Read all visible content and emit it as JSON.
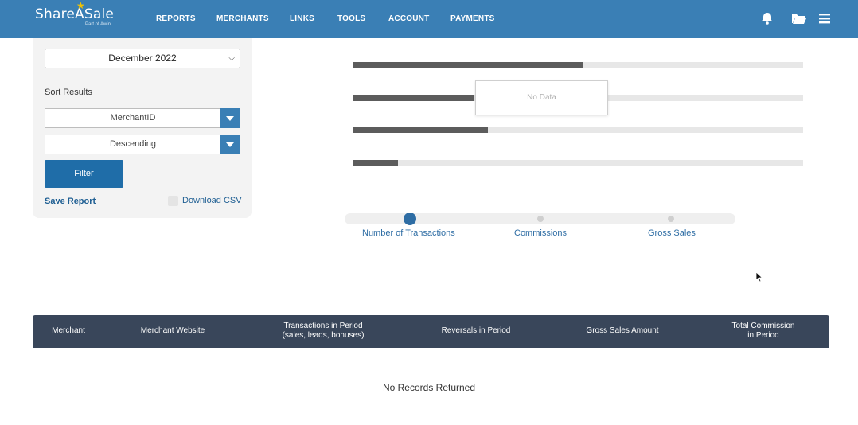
{
  "brand": {
    "name": "ShareASale",
    "tagline": "Part of Awin",
    "primary_color": "#3a7fb5",
    "star_color": "#f2c200"
  },
  "nav": {
    "items": [
      {
        "label": "REPORTS"
      },
      {
        "label": "MERCHANTS"
      },
      {
        "label": "LINKS"
      },
      {
        "label": "TOOLS"
      },
      {
        "label": "ACCOUNT"
      },
      {
        "label": "PAYMENTS"
      }
    ],
    "icons": [
      "bell-icon",
      "folder-icon",
      "menu-icon"
    ]
  },
  "filters": {
    "period": "December 2022",
    "sort_label": "Sort Results",
    "sort_field": "MerchantID",
    "sort_order": "Descending",
    "filter_button": "Filter",
    "save_report": "Save Report",
    "download_csv": "Download CSV",
    "download_csv_checked": false
  },
  "chart_data": {
    "type": "bar",
    "orientation": "horizontal",
    "series": [
      {
        "values": [
          0.51,
          0.27,
          0.3,
          0.1
        ]
      }
    ],
    "overlay_message": "No Data",
    "colors": {
      "fill": "#5c5c5c",
      "track": "#e7e7e7"
    }
  },
  "metric_selector": {
    "options": [
      "Number of Transactions",
      "Commissions",
      "Gross Sales"
    ],
    "selected_index": 0,
    "active_color": "#2e6da4"
  },
  "table": {
    "columns": [
      [
        "Merchant"
      ],
      [
        "Merchant Website"
      ],
      [
        "Transactions in Period",
        "(sales, leads, bonuses)"
      ],
      [
        "Reversals in Period"
      ],
      [
        "Gross Sales Amount"
      ],
      [
        "Total Commission",
        "in Period"
      ]
    ],
    "header_color": "#39465a",
    "empty_message": "No Records Returned"
  }
}
